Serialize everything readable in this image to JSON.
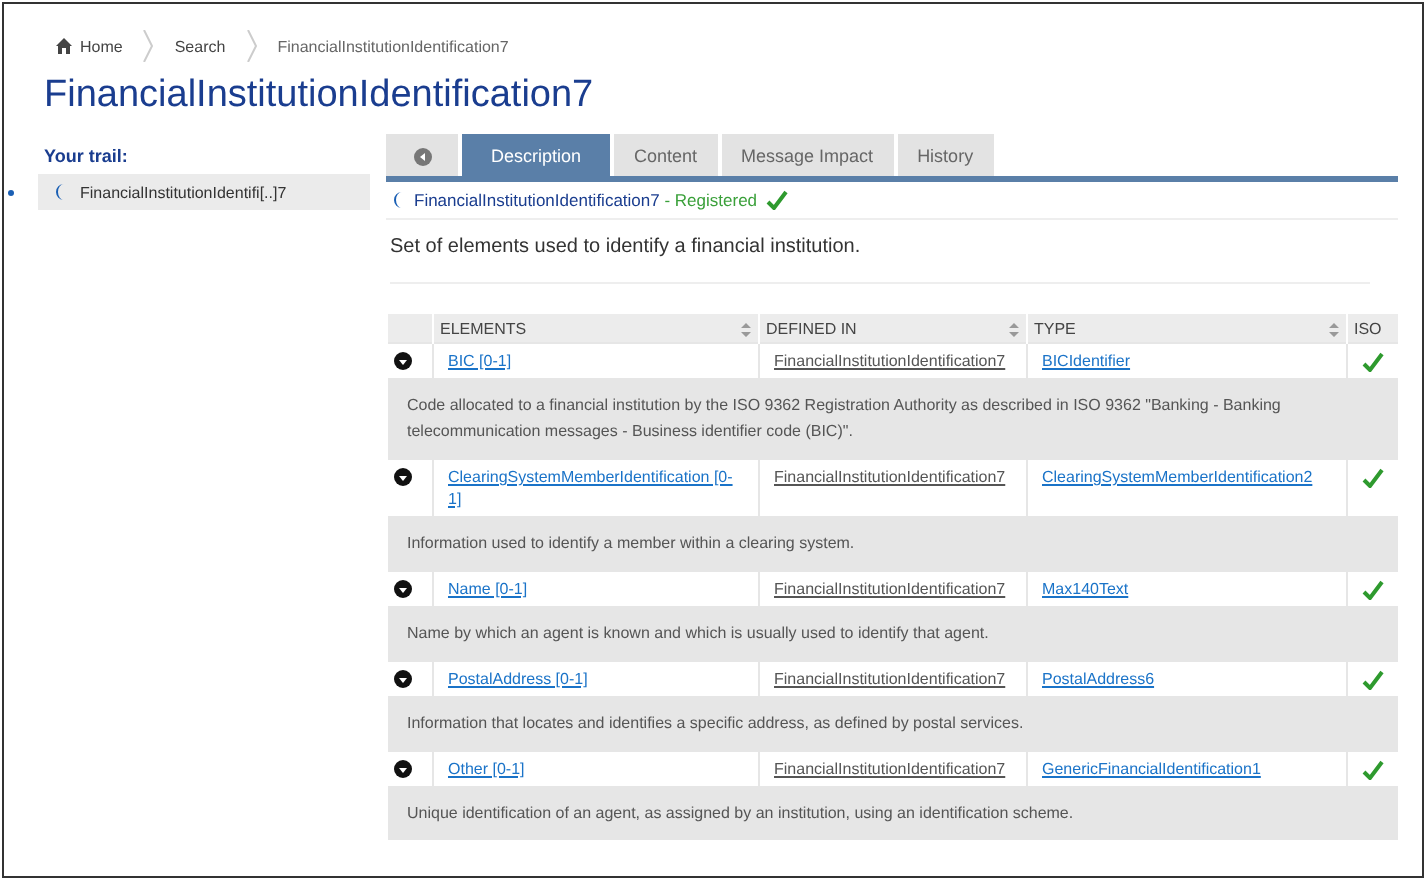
{
  "breadcrumb": [
    {
      "label": "Home",
      "kind": "home"
    },
    {
      "label": "Search",
      "kind": "link"
    },
    {
      "label": "FinancialInstitutionIdentification7",
      "kind": "current"
    }
  ],
  "title": "FinancialInstitutionIdentification7",
  "trail": {
    "heading": "Your trail:",
    "items": [
      {
        "label": "FinancialInstitutionIdentifi[..]7"
      }
    ]
  },
  "tabs": [
    {
      "kind": "back",
      "selected": false
    },
    {
      "label": "Description",
      "selected": true
    },
    {
      "label": "Content",
      "selected": false
    },
    {
      "label": "Message Impact",
      "selected": false
    },
    {
      "label": "History",
      "selected": false
    }
  ],
  "status": {
    "name": "FinancialInstitutionIdentification7",
    "state": " - Registered",
    "registered": true
  },
  "description": "Set of elements used to identify a financial institution.",
  "table": {
    "columns": [
      "ELEMENTS",
      "DEFINED IN",
      "TYPE",
      "ISO"
    ],
    "rows": [
      {
        "element": "BIC [0-1]",
        "defined_in": "FinancialInstitutionIdentification7",
        "type": "BICIdentifier",
        "iso": true,
        "definition": "Code allocated to a financial institution by the ISO 9362 Registration Authority as described in ISO 9362 \"Banking - Banking telecommunication messages - Business identifier code (BIC)\"."
      },
      {
        "element": "ClearingSystemMemberIdentification [0-1]",
        "defined_in": "FinancialInstitutionIdentification7",
        "type": "ClearingSystemMemberIdentification2",
        "iso": true,
        "definition": "Information used to identify a member within a clearing system."
      },
      {
        "element": "Name [0-1]",
        "defined_in": "FinancialInstitutionIdentification7",
        "type": "Max140Text",
        "iso": true,
        "definition": "Name by which an agent is known and which is usually used to identify that agent."
      },
      {
        "element": "PostalAddress [0-1]",
        "defined_in": "FinancialInstitutionIdentification7",
        "type": "PostalAddress6",
        "iso": true,
        "definition": "Information that locates and identifies a specific address, as defined by postal services."
      },
      {
        "element": "Other [0-1]",
        "defined_in": "FinancialInstitutionIdentification7",
        "type": "GenericFinancialIdentification1",
        "iso": true,
        "definition": "Unique identification of an agent, as assigned by an institution, using an identification scheme."
      }
    ]
  }
}
